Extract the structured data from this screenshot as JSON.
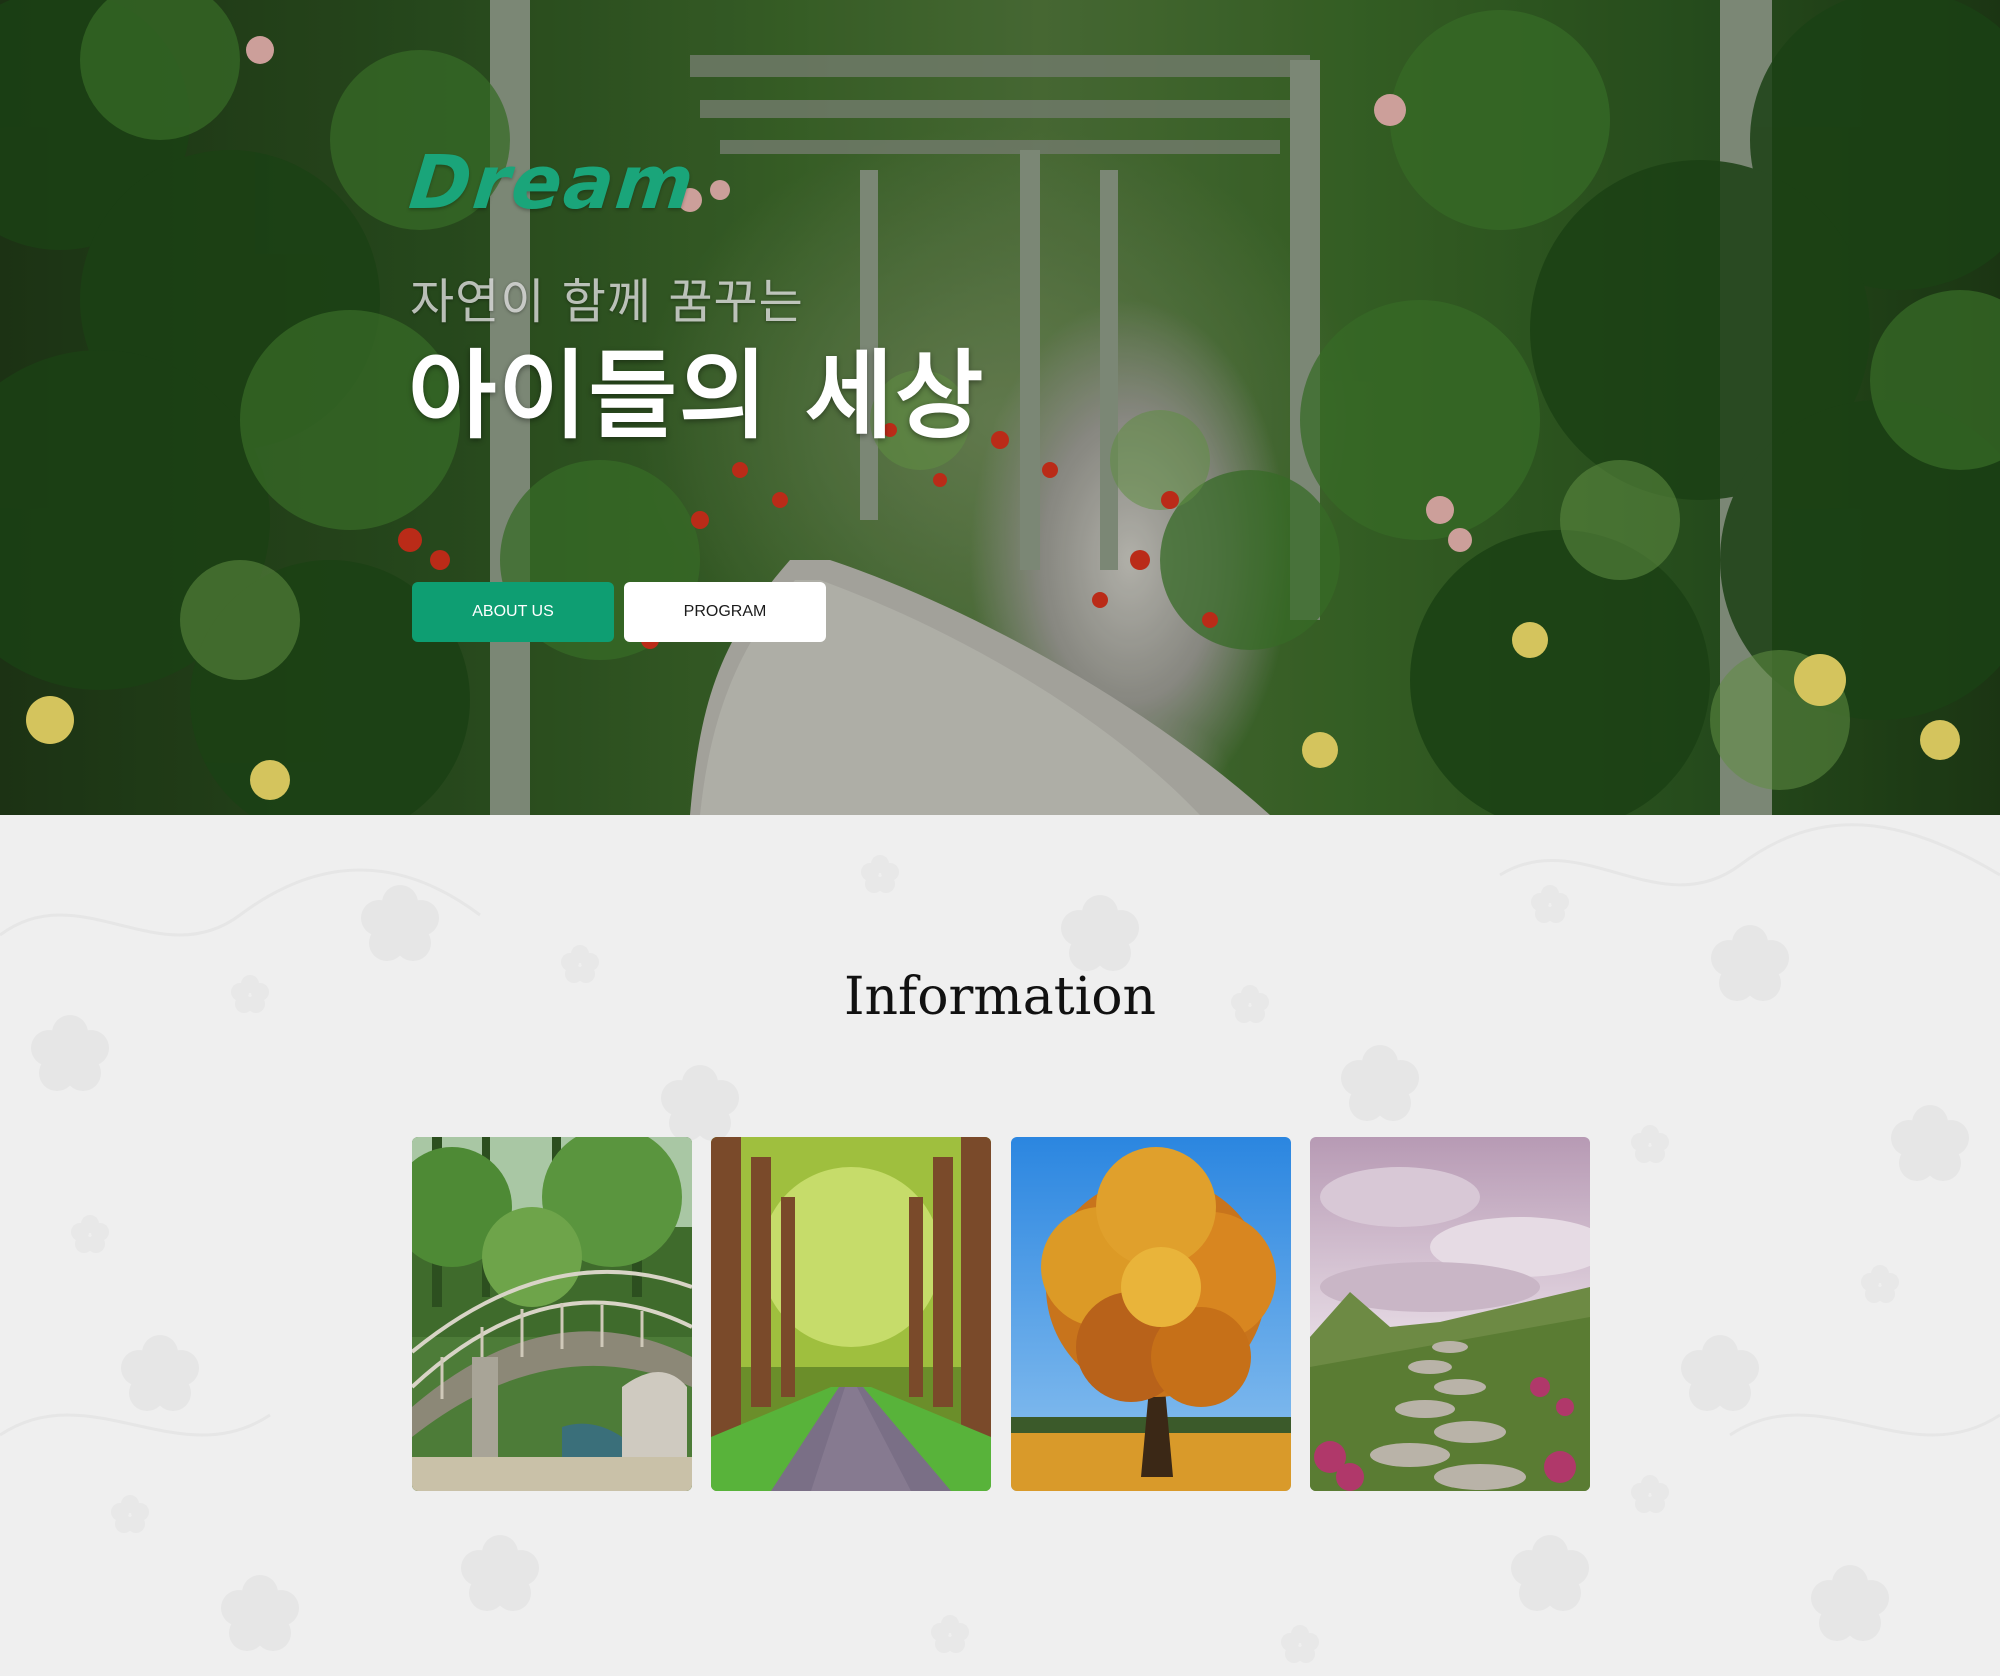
{
  "hero": {
    "logo": "Dream",
    "subtitle": "자연이 함께 꿈꾸는",
    "title": "아이들의 세상",
    "buttons": {
      "about": "ABOUT US",
      "program": "PROGRAM"
    }
  },
  "information": {
    "title": "Information",
    "cards": [
      {
        "image": "wooden-bridge-garden"
      },
      {
        "image": "tree-lined-path"
      },
      {
        "image": "autumn-tree"
      },
      {
        "image": "stone-path-hill"
      }
    ]
  },
  "colors": {
    "accent": "#0e9e72",
    "logo": "#1aa57a",
    "background": "#efefef"
  }
}
